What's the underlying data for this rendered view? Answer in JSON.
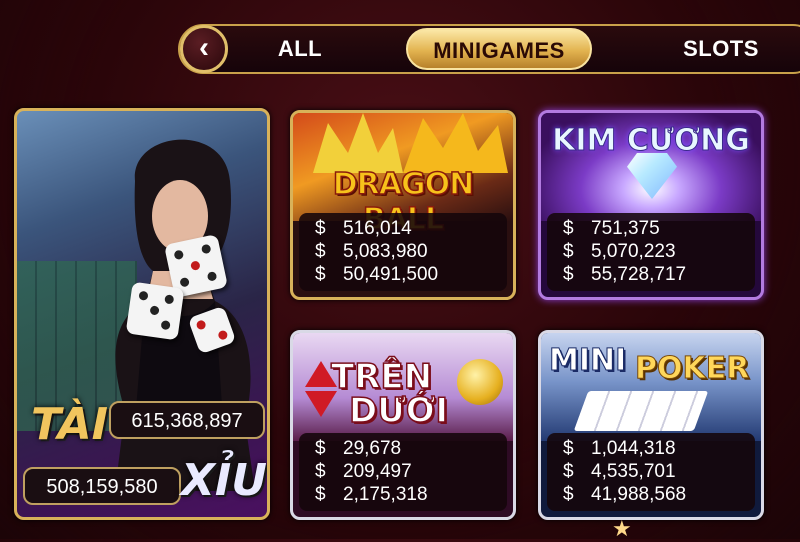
{
  "nav": {
    "back_icon": "chevron-left-icon",
    "back_glyph": "‹",
    "tabs": [
      {
        "label": "ALL",
        "active": false
      },
      {
        "label": "MINIGAMES",
        "active": true
      },
      {
        "label": "SLOTS",
        "active": false
      }
    ]
  },
  "taixiu": {
    "tai_label": "TÀI",
    "xiu_label": "XỈU",
    "tai_amount": "615,368,897",
    "xiu_amount": "508,159,580"
  },
  "games": [
    {
      "id": "dragonball",
      "logo": "DRAGON BALL",
      "currency": "$",
      "jackpots": [
        "516,014",
        "5,083,980",
        "50,491,500"
      ]
    },
    {
      "id": "kimcuong",
      "logo": "KIM CƯƠNG",
      "currency": "$",
      "jackpots": [
        "751,375",
        "5,070,223",
        "55,728,717"
      ]
    },
    {
      "id": "trenduoi",
      "logo_top": "TRÊN",
      "logo_bottom": "DƯỚI",
      "currency": "$",
      "jackpots": [
        "29,678",
        "209,497",
        "2,175,318"
      ]
    },
    {
      "id": "minipoker",
      "logo_left": "MINI",
      "logo_right": "POKER",
      "currency": "$",
      "jackpots": [
        "1,044,318",
        "4,535,701",
        "41,988,568"
      ]
    }
  ],
  "colors": {
    "gold": "#d8b25a",
    "purple": "#b27be0",
    "silver": "#d9d9e6",
    "tab_active": "#e2b34f"
  },
  "decor": {
    "star_icon": "★"
  }
}
